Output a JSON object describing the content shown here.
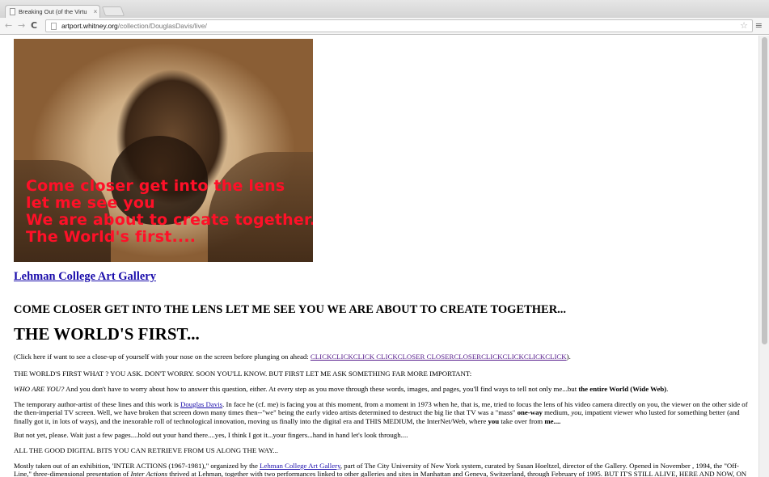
{
  "browser": {
    "tab_title": "Breaking Out (of the Virtu",
    "tab_close": "×",
    "url_host": "artport.whitney.org",
    "url_path": "/collection/DouglasDavis/live/",
    "back": "←",
    "forward": "→",
    "reload": "C",
    "star": "☆",
    "menu": "≡"
  },
  "hero": {
    "caption": "Come closer get into the lens\nlet me see you\nWe are about to create together...\nThe World's first...."
  },
  "content": {
    "gallery_link": "Lehman College Art Gallery",
    "heading_small": "COME CLOSER GET INTO THE LENS LET ME SEE YOU WE ARE ABOUT TO CREATE TOGETHER...",
    "heading_big": "THE WORLD'S FIRST...",
    "p1_text": "(Click here if want to see a close-up of yourself with your nose on the screen before plunging on ahead: ",
    "p1_link": "CLICKCLICKCLICK CLICKCLOSER CLOSERCLOSERCLICKCLICKCLICKCLICK",
    "p1_end": ").",
    "p2": "THE WORLD'S FIRST WHAT ? YOU ASK. DON'T WORRY. SOON YOU'LL KNOW. BUT FIRST LET ME ASK SOMETHING FAR MORE IMPORTANT:",
    "p3_lead": "WHO ARE YOU?",
    "p3_text": " And you don't have to worry about how to answer this question, either. At every step as you move through these words, images, and pages, you'll find ways to tell not only me...but ",
    "p3_bold": "the entire World (Wide Web)",
    "p3_end": ".",
    "p4_a": "The temporary author-artist of these lines and this work is ",
    "p4_link": "Douglas Davis",
    "p4_b": ". In face he (cf. me) is facing you at this moment, from a moment in 1973 when he, that is, me, tried to focus the lens of his video camera directly on you, the viewer on the other side of the then-imperial TV screen. Well, we have broken that screen down many times then--\"we\" being the early video artists determined to destruct the big lie that TV was a \"mass\" ",
    "p4_bold1": "one-way",
    "p4_c": " medium, ",
    "p4_ital": "you",
    "p4_d": ", impatient viewer who lusted for something better (and finally got it, in lots of ways), and the inexorable roll of technological innovation, moving us finally into the digital era and THIS MEDIUM, the InterNet/Web, where ",
    "p4_bold2": "you",
    "p4_e": " take over from ",
    "p4_bold3": "me....",
    "p5": "But not yet, please. Wait just a few pages....hold out your hand there....yes, I think I got it...your fingers...hand in hand let's look through....",
    "p6": "ALL THE GOOD DIGITAL BITS YOU CAN RETRIEVE FROM US ALONG THE WAY...",
    "p7_a": "Mostly taken out of an exhibition, 'INTER ACTIONS (1967-1981),\" organized by the ",
    "p7_link": "Lehman College Art Gallery",
    "p7_b": ", part of The City University of New York system, curated by Susan Hoeltzel, director of the Gallery. Opened in November , 1994, the \"Off-Line,\" three-dimensional presentation of ",
    "p7_ital": "Inter Actions",
    "p7_c": " thrived at Lehman, together with two performances linked to other galleries and sites in Manhattan and Geneva, Switzerland, through February of 1995. BUT IT'S STILL ALIVE, HERE AND NOW, ON"
  }
}
